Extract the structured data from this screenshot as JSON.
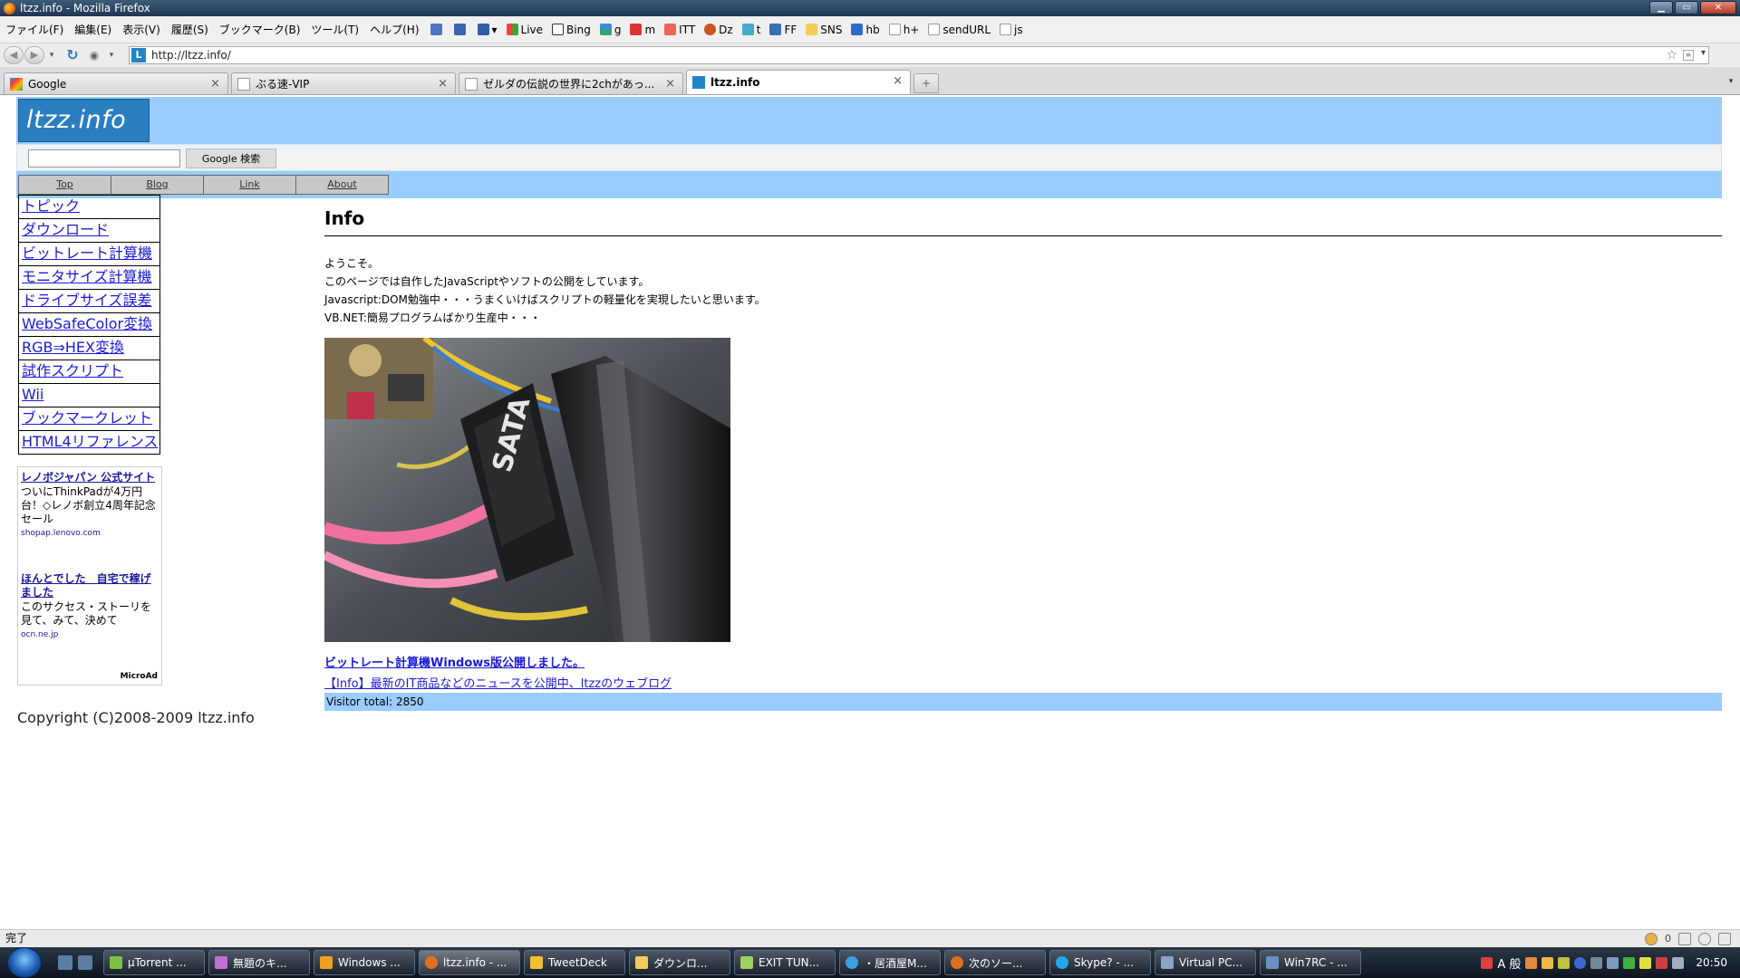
{
  "window": {
    "title": "ltzz.info - Mozilla Firefox"
  },
  "menubar": {
    "items": [
      "ファイル(F)",
      "編集(E)",
      "表示(V)",
      "履歴(S)",
      "ブックマーク(B)",
      "ツール(T)",
      "ヘルプ(H)"
    ],
    "bookmarks": [
      "Live",
      "Bing",
      "g",
      "m",
      "ITT",
      "Dz",
      "t",
      "FF",
      "SNS",
      "hb",
      "h+",
      "sendURL",
      "js"
    ]
  },
  "navbar": {
    "url": "http://ltzz.info/"
  },
  "tabs": [
    {
      "label": "Google"
    },
    {
      "label": "ぶる速-VIP"
    },
    {
      "label": "ゼルダの伝説の世界に2chがあっ..."
    },
    {
      "label": "ltzz.info"
    }
  ],
  "site": {
    "logo": "ltzz.info",
    "search_button": "Google 検索",
    "topnav": [
      "Top",
      "Blog",
      "Link",
      "About"
    ],
    "sidebar": [
      "トピック",
      "ダウンロード",
      "ビットレート計算機",
      "モニタサイズ計算機",
      "ドライブサイズ誤差",
      "WebSafeColor変換",
      "RGB⇒HEX変換",
      "試作スクリプト",
      "Wii",
      "ブックマークレット",
      "HTML4リファレンス"
    ],
    "ads": [
      {
        "title": "レノボジャパン 公式サイト",
        "text": "ついにThinkPadが4万円台！◇レノボ創立4周年記念セール",
        "url": "shopap.lenovo.com"
      },
      {
        "title": "ほんとでした　自宅で稼げました",
        "text": "このサクセス・ストーリを見て、みて、決めて",
        "url": "ocn.ne.jp"
      }
    ],
    "ad_brand": "MicroAd",
    "copyright": "Copyright (C)2008-2009 ltzz.info",
    "main": {
      "heading": "Info",
      "intro": [
        "ようこそ。",
        "このページでは自作したJavaScriptやソフトの公開をしています。",
        "Javascript:DOM勉強中・・・うまくいけばスクリプトの軽量化を実現したいと思います。",
        "VB.NET:簡易プログラムばかり生産中・・・"
      ],
      "photo_label": "SATA",
      "article_link": "ビットレート計算機Windows版公開しました。",
      "blog_link": "【Info】最新のIT商品などのニュースを公開中、ltzzのウェブログ",
      "visitor": "Visitor total: 2850"
    }
  },
  "statusbar": {
    "text": "完了",
    "count": "0"
  },
  "taskbar": {
    "tasks": [
      "µTorrent ...",
      "無題のキ...",
      "Windows ...",
      "ltzz.info - ...",
      "TweetDeck",
      "ダウンロ...",
      "EXIT TUN...",
      "・居酒屋M...",
      "次のソー...",
      "Skype? - ...",
      "Virtual PC...",
      "Win7RC - ..."
    ],
    "ime": "A 般",
    "clock": "20:50"
  },
  "colors": {
    "header_bg": "#99ccff",
    "logo_bg": "#2a7fc1",
    "link": "#1a1ad8"
  }
}
